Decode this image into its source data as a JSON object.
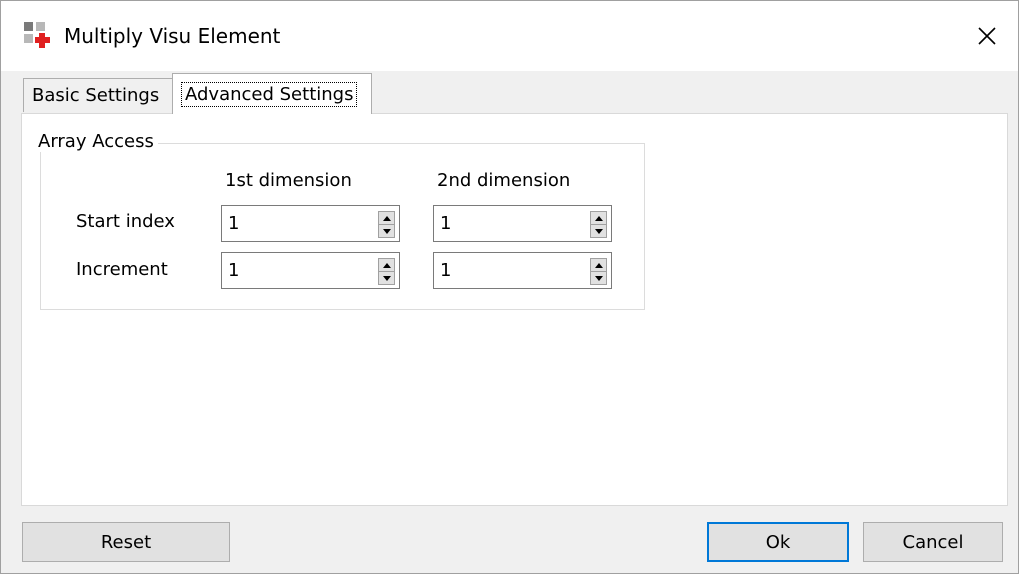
{
  "window": {
    "title": "Multiply Visu Element"
  },
  "tabs": [
    {
      "label": "Basic Settings",
      "selected": false
    },
    {
      "label": "Advanced Settings",
      "selected": true
    }
  ],
  "array_access": {
    "legend": "Array Access",
    "columns": [
      "1st dimension",
      "2nd dimension"
    ],
    "rows": [
      {
        "label": "Start index",
        "values": [
          "1",
          "1"
        ]
      },
      {
        "label": "Increment",
        "values": [
          "1",
          "1"
        ]
      }
    ]
  },
  "buttons": {
    "reset": "Reset",
    "ok": "Ok",
    "cancel": "Cancel"
  },
  "colors": {
    "focus_border": "#0078d7",
    "icon_red": "#e02020",
    "icon_gray": "#7a7a7a"
  }
}
